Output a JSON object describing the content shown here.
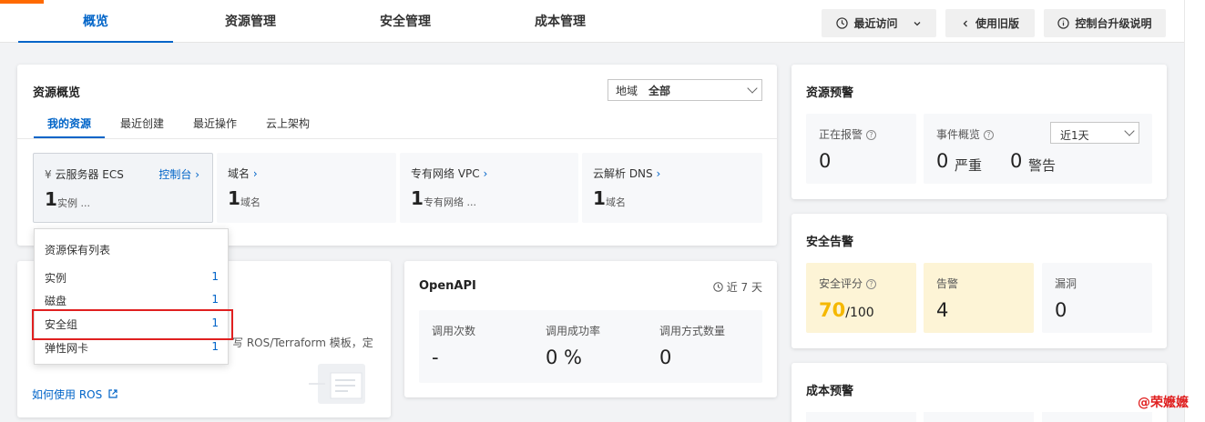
{
  "nav": {
    "tabs": [
      {
        "label": "概览",
        "active": true
      },
      {
        "label": "资源管理"
      },
      {
        "label": "安全管理"
      },
      {
        "label": "成本管理"
      }
    ],
    "recent_label": "最近访问",
    "old_version_label": "使用旧版",
    "upgrade_label": "控制台升级说明"
  },
  "overview": {
    "title": "资源概览",
    "region_label": "地域",
    "region_value": "全部",
    "subtabs": [
      "我的资源",
      "最近创建",
      "最近操作",
      "云上架构"
    ],
    "resources": [
      {
        "name": "云服务器 ECS",
        "console_label": "控制台",
        "count": "1",
        "unit": "实例 ..."
      },
      {
        "name": "域名",
        "count": "1",
        "unit": "域名"
      },
      {
        "name": "专有网络 VPC",
        "count": "1",
        "unit": "专有网络 ..."
      },
      {
        "name": "云解析 DNS",
        "count": "1",
        "unit": "域名"
      }
    ]
  },
  "dropdown": {
    "title": "资源保有列表",
    "items": [
      {
        "label": "实例",
        "count": "1"
      },
      {
        "label": "磁盘",
        "count": "1"
      },
      {
        "label": "安全组",
        "count": "1"
      },
      {
        "label": "弹性网卡",
        "count": "1"
      }
    ]
  },
  "ros_card": {
    "partial_text": "写 ROS/Terraform 模板，定",
    "link_label": "如何使用 ROS"
  },
  "openapi": {
    "title": "OpenAPI",
    "period": "近 7 天",
    "metrics": [
      {
        "label": "调用次数",
        "value": "-"
      },
      {
        "label": "调用成功率",
        "value": "0 %"
      },
      {
        "label": "调用方式数量",
        "value": "0"
      }
    ]
  },
  "alerts": {
    "title": "资源预警",
    "firing_label": "正在报警",
    "firing_value": "0",
    "events_label": "事件概览",
    "period_value": "近1天",
    "severe_value": "0",
    "severe_label": "严重",
    "warning_value": "0",
    "warning_label": "警告"
  },
  "security": {
    "title": "安全告警",
    "score_label": "安全评分",
    "score_value": "70",
    "score_max": "/100",
    "alarm_label": "告警",
    "alarm_value": "4",
    "vuln_label": "漏洞",
    "vuln_value": "0"
  },
  "cost": {
    "title": "成本预警"
  },
  "watermark": "@荣嬷嬷",
  "colors": {
    "accent": "#0064c8",
    "brand": "#ff6a00",
    "score": "#f5b800",
    "highlight_red": "#e02020"
  }
}
